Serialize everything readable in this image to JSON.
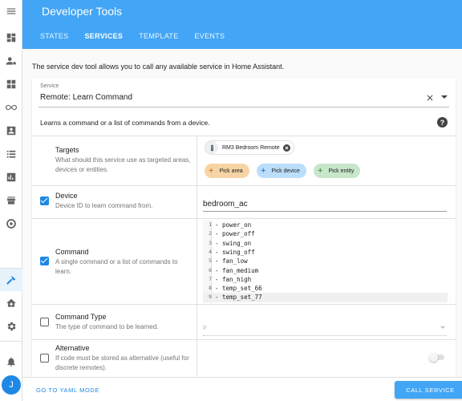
{
  "header": {
    "title": "Developer Tools",
    "tabs": [
      {
        "label": "STATES",
        "active": false
      },
      {
        "label": "SERVICES",
        "active": true
      },
      {
        "label": "TEMPLATE",
        "active": false
      },
      {
        "label": "EVENTS",
        "active": false
      }
    ]
  },
  "sidebar": {
    "items": [
      "menu-icon",
      "dashboard-icon",
      "person-cog-icon",
      "dashboard-grid-icon",
      "infinity-icon",
      "account-box-icon",
      "list-icon",
      "chart-icon",
      "store-icon",
      "radar-icon",
      "hammer-icon",
      "home-plus-icon",
      "gear-icon",
      "bell-icon"
    ],
    "active_item": "hammer-icon",
    "avatar_initial": "J"
  },
  "intro": "The service dev tool allows you to call any available service in Home Assistant.",
  "service": {
    "label": "Service",
    "value": "Remote: Learn Command",
    "description": "Learns a command or a list of commands from a device."
  },
  "targets": {
    "title": "Targets",
    "subtitle": "What should this service use as targeted areas, devices or entities.",
    "chip_label": "RM3 Bedroom Remote",
    "pick_area": "Pick area",
    "pick_device": "Pick device",
    "pick_entity": "Pick entity"
  },
  "device": {
    "title": "Device",
    "subtitle": "Device ID to learn command from.",
    "value": "bedroom_ac",
    "checked": true
  },
  "command": {
    "title": "Command",
    "subtitle": "A single command or a list of commands to learn.",
    "checked": true,
    "lines": [
      {
        "n": "1",
        "text": "- power_on"
      },
      {
        "n": "2",
        "text": "- power_off"
      },
      {
        "n": "3",
        "text": "- swing_on"
      },
      {
        "n": "4",
        "text": "- swing_off"
      },
      {
        "n": "5",
        "text": "- fan_low"
      },
      {
        "n": "6",
        "text": "- fan_medium"
      },
      {
        "n": "7",
        "text": "- fan_high"
      },
      {
        "n": "8",
        "text": "- temp_set_66"
      },
      {
        "n": "9",
        "text": "- temp_set_77"
      }
    ]
  },
  "command_type": {
    "title": "Command Type",
    "subtitle": "The type of command to be learned.",
    "value": "ir",
    "checked": false
  },
  "alternative": {
    "title": "Alternative",
    "subtitle": "If code must be stored as alternative (useful for discrete remotes).",
    "checked": false,
    "toggle_on": false
  },
  "footer": {
    "yaml_label": "GO TO YAML MODE",
    "call_label": "CALL SERVICE"
  },
  "colors": {
    "primary": "#42a5f5",
    "accent": "#1e88e5"
  }
}
